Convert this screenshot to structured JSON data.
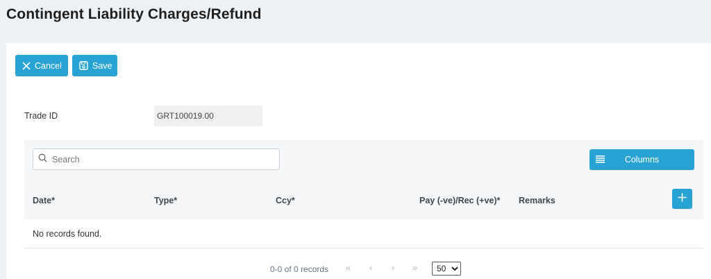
{
  "page": {
    "title": "Contingent Liability Charges/Refund"
  },
  "toolbar": {
    "cancel_label": "Cancel",
    "save_label": "Save"
  },
  "form": {
    "trade_id_label": "Trade ID",
    "trade_id_value": "GRT100019.00"
  },
  "grid": {
    "search_placeholder": "Search",
    "columns_label": "Columns",
    "headers": [
      "Date*",
      "Type*",
      "Ccy*",
      "Pay (-ve)/Rec (+ve)*",
      "Remarks"
    ],
    "empty_message": "No records found.",
    "records_summary": "0-0 of 0 records",
    "pager": {
      "first": "«",
      "prev": "‹",
      "next": "›",
      "last": "»"
    },
    "page_size": "50",
    "page_size_options": [
      "50"
    ]
  },
  "colors": {
    "accent": "#29a3d4",
    "background": "#eef1f4",
    "grid_bg": "#f4f6f8"
  },
  "icons": [
    "close-icon",
    "save-icon",
    "search-icon",
    "columns-list-icon",
    "plus-icon"
  ]
}
